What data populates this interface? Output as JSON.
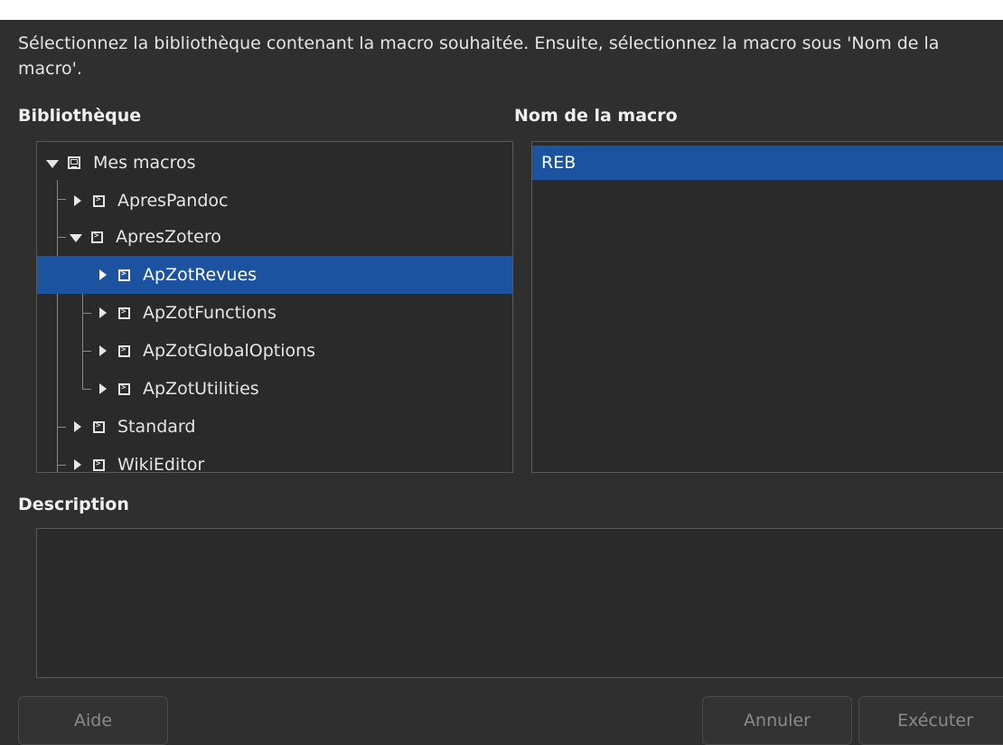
{
  "instructions": "Sélectionnez la bibliothèque contenant la macro souhaitée. Ensuite, sélectionnez la macro sous 'Nom de la macro'.",
  "library_label": "Bibliothèque",
  "macro_name_label": "Nom de la macro",
  "description_label": "Description",
  "tree": {
    "root": {
      "label": "Mes macros",
      "expanded": true,
      "icon": "computer-icon"
    },
    "items": [
      {
        "label": "ApresPandoc",
        "expanded": false,
        "icon": "macro-library-icon"
      },
      {
        "label": "ApresZotero",
        "expanded": true,
        "icon": "macro-library-icon"
      },
      {
        "label": "ApZotRevues",
        "expanded": false,
        "icon": "macro-library-icon",
        "selected": true
      },
      {
        "label": "ApZotFunctions",
        "expanded": false,
        "icon": "macro-library-icon"
      },
      {
        "label": "ApZotGlobalOptions",
        "expanded": false,
        "icon": "macro-library-icon"
      },
      {
        "label": "ApZotUtilities",
        "expanded": false,
        "icon": "macro-library-icon"
      },
      {
        "label": "Standard",
        "expanded": false,
        "icon": "macro-library-icon"
      },
      {
        "label": "WikiEditor",
        "expanded": false,
        "icon": "macro-library-icon"
      }
    ]
  },
  "macros": [
    {
      "label": "REB",
      "selected": true
    }
  ],
  "buttons": {
    "help": "Aide",
    "cancel": "Annuler",
    "run": "Exécuter"
  },
  "colors": {
    "background": "#2f2f2f",
    "selection": "#1b53a0",
    "disabled_text": "#8a8a8a"
  }
}
